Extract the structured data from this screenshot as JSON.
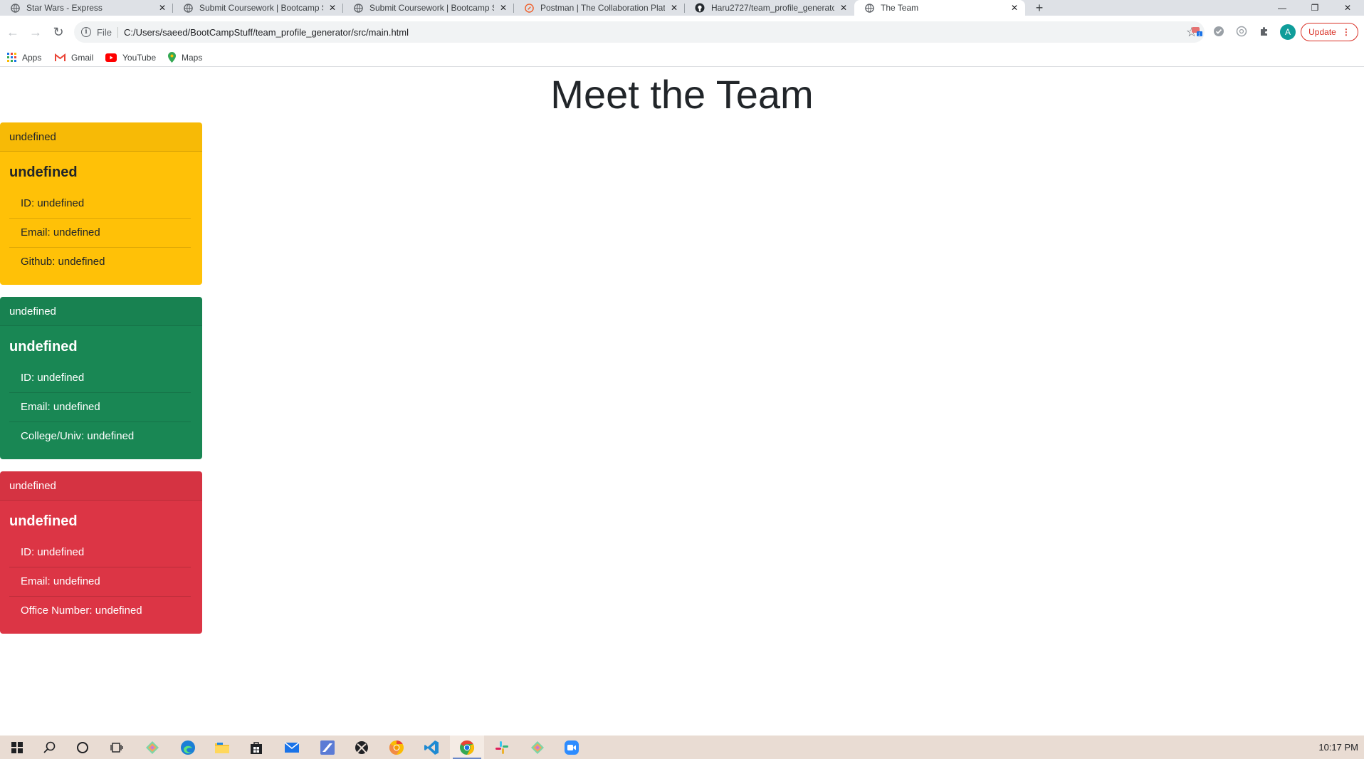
{
  "browser": {
    "tabs": [
      {
        "title": "Star Wars - Express",
        "icon": "globe-icon"
      },
      {
        "title": "Submit Coursework | Bootcamp S",
        "icon": "globe-icon"
      },
      {
        "title": "Submit Coursework | Bootcamp S",
        "icon": "globe-icon"
      },
      {
        "title": "Postman | The Collaboration Plat",
        "icon": "postman-icon"
      },
      {
        "title": "Haru2727/team_profile_generato",
        "icon": "github-icon"
      },
      {
        "title": "The Team",
        "icon": "globe-icon"
      }
    ],
    "active_tab_index": 5,
    "address": {
      "scheme_label": "File",
      "url": "C:/Users/saeed/BootCampStuff/team_profile_generator/src/main.html"
    },
    "avatar_initial": "A",
    "update_label": "Update",
    "bookmarks": [
      {
        "label": "Apps",
        "icon": "apps-grid-icon"
      },
      {
        "label": "Gmail",
        "icon": "gmail-icon"
      },
      {
        "label": "YouTube",
        "icon": "youtube-icon"
      },
      {
        "label": "Maps",
        "icon": "maps-pin-icon"
      }
    ]
  },
  "page": {
    "title": "Meet the Team",
    "cards": [
      {
        "variant": "warning",
        "color": "#ffc107",
        "header": "undefined",
        "name": "undefined",
        "rows": [
          "ID: undefined",
          "Email: undefined",
          "Github: undefined"
        ]
      },
      {
        "variant": "success",
        "color": "#198754",
        "header": "undefined",
        "name": "undefined",
        "rows": [
          "ID: undefined",
          "Email: undefined",
          "College/Univ: undefined"
        ]
      },
      {
        "variant": "danger",
        "color": "#dc3545",
        "header": "undefined",
        "name": "undefined",
        "rows": [
          "ID: undefined",
          "Email: undefined",
          "Office Number: undefined"
        ]
      }
    ]
  },
  "taskbar": {
    "clock": "10:17 PM",
    "icons": [
      "windows-start-icon",
      "search-icon",
      "cortana-icon",
      "task-view-icon",
      "gitkraken-icon",
      "edge-icon",
      "file-explorer-icon",
      "store-icon",
      "mail-icon",
      "app-icon",
      "xbox-icon",
      "chrome-canary-icon",
      "vscode-icon",
      "chrome-icon",
      "slack-icon",
      "gitkraken-icon",
      "zoom-icon"
    ]
  }
}
